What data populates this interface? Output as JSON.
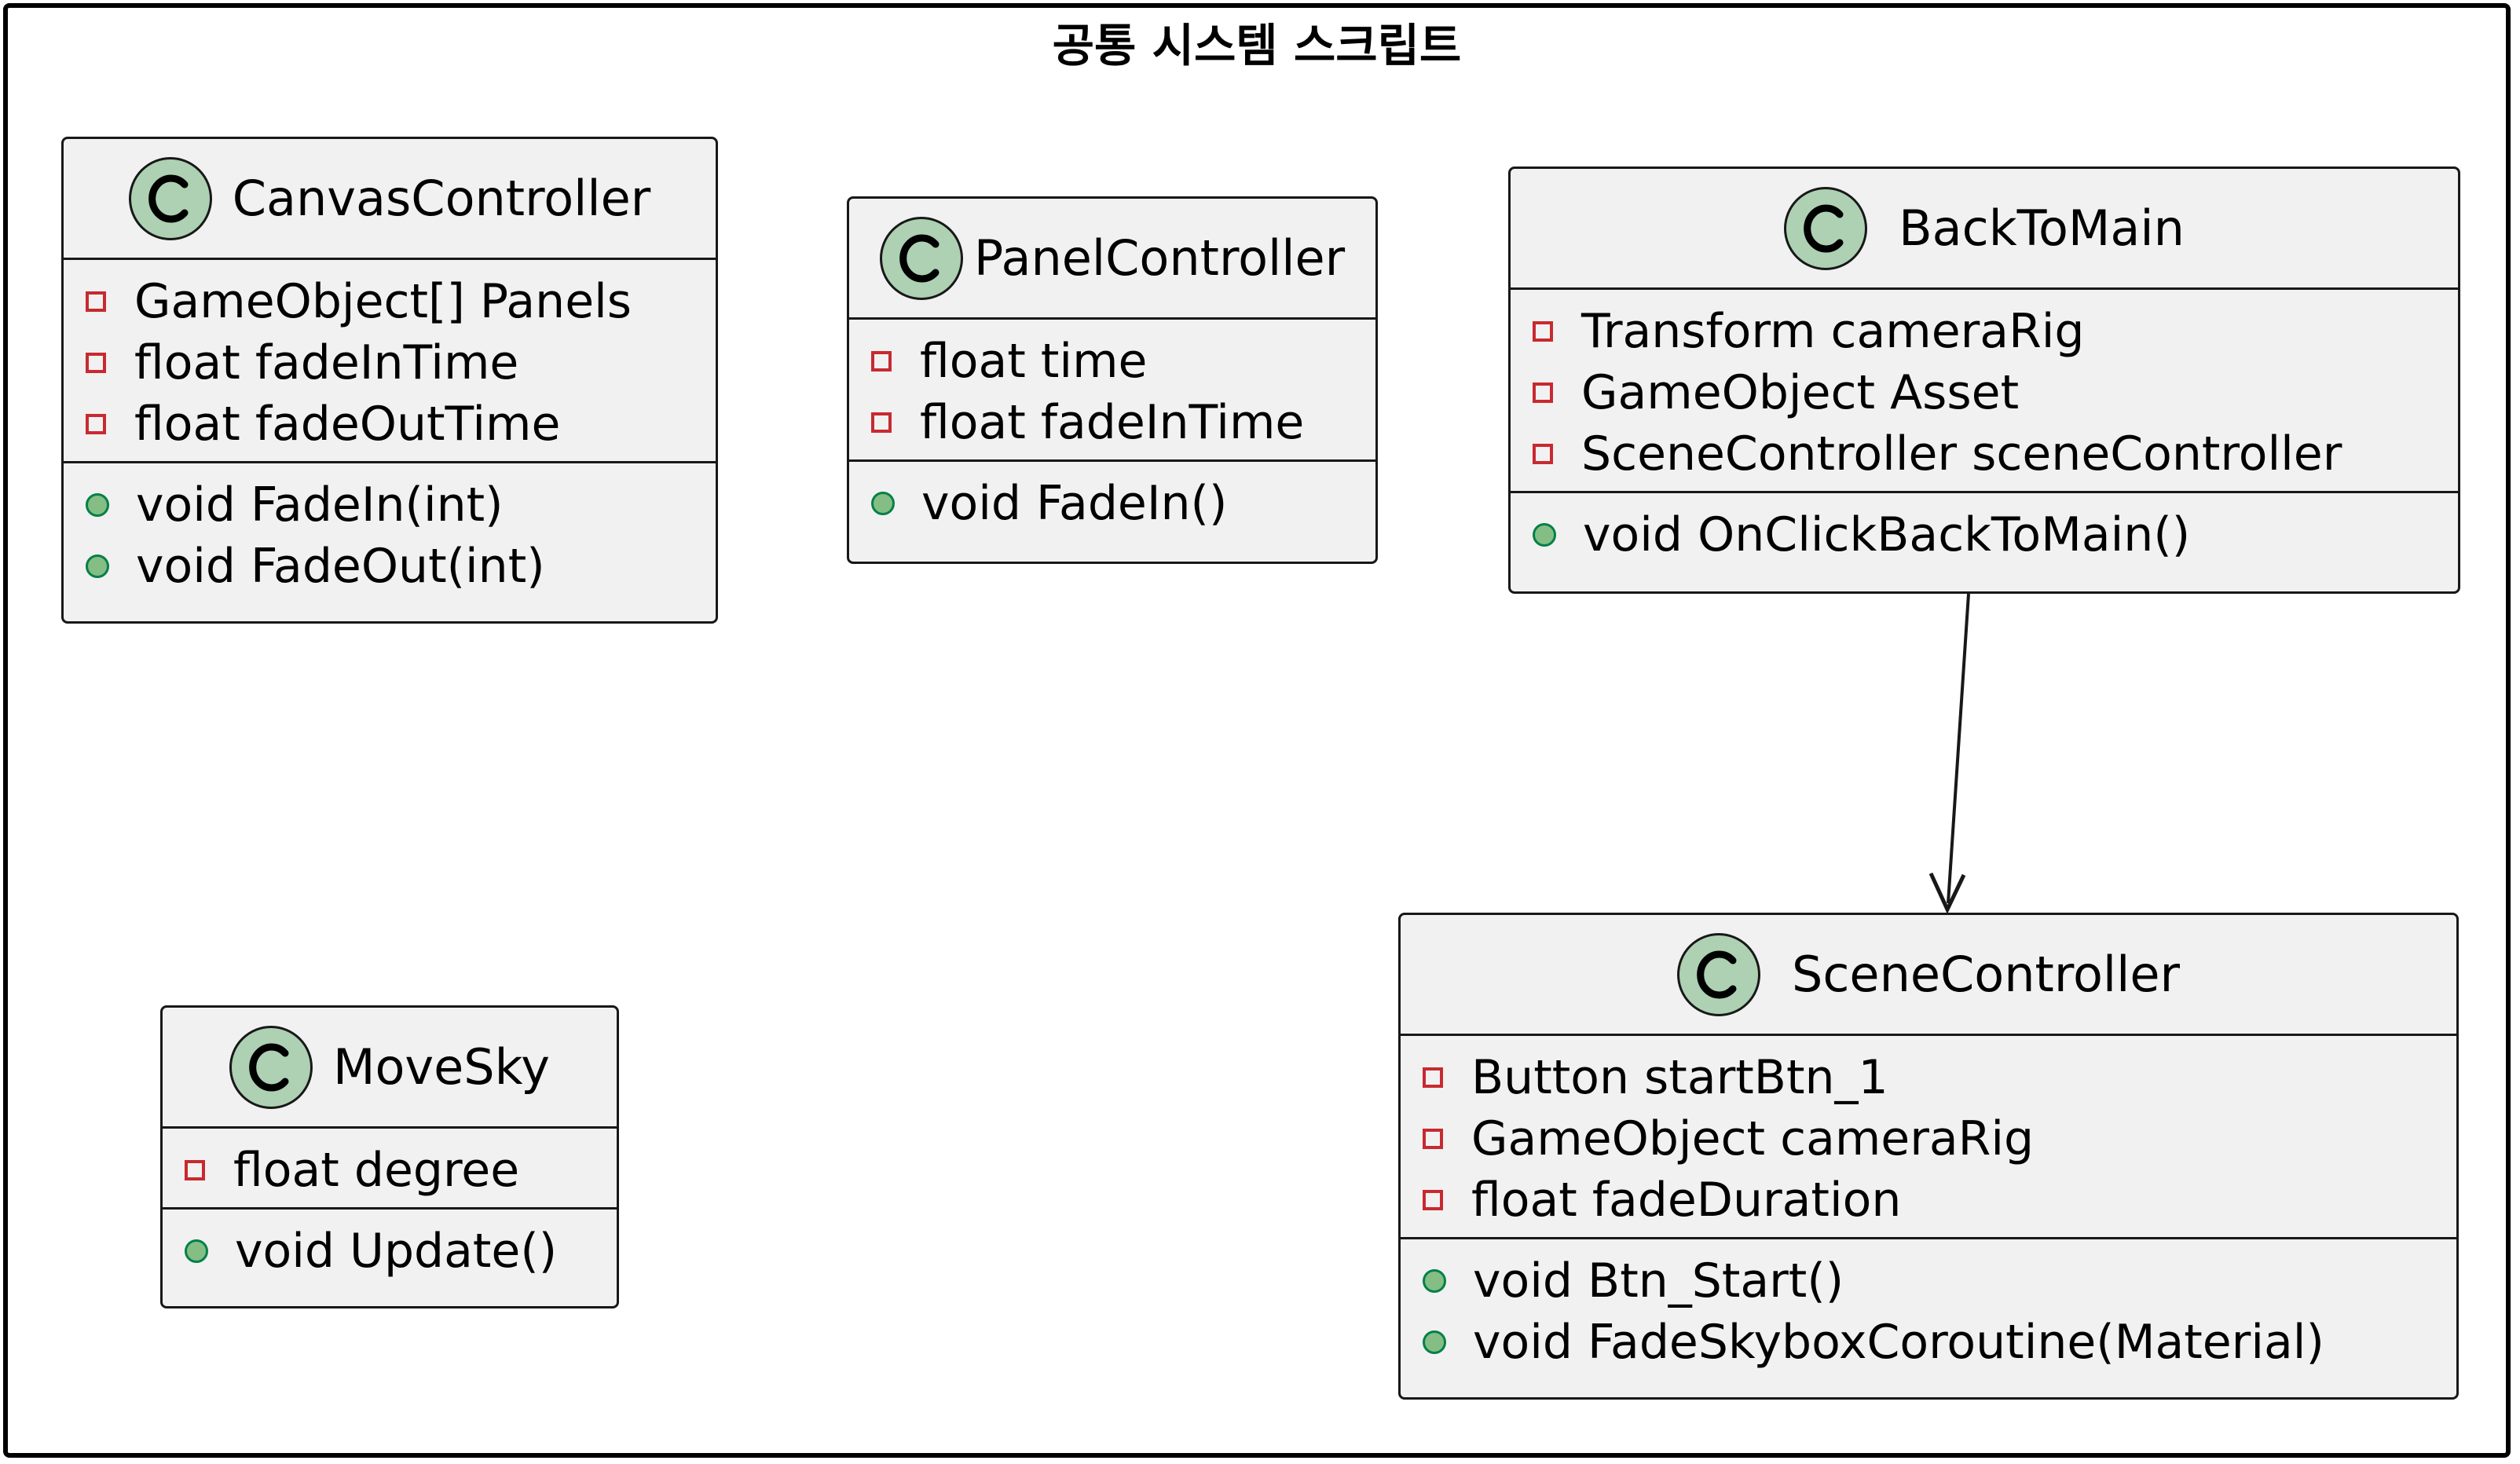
{
  "package": {
    "title": "공통 시스템 스크립트"
  },
  "classes": {
    "canvas_controller": {
      "name": "CanvasController",
      "fields": [
        "GameObject[] Panels",
        "float fadeInTime",
        "float fadeOutTime"
      ],
      "methods": [
        "void FadeIn(int)",
        "void FadeOut(int)"
      ]
    },
    "panel_controller": {
      "name": "PanelController",
      "fields": [
        "float time",
        "float fadeInTime"
      ],
      "methods": [
        "void FadeIn()"
      ]
    },
    "back_to_main": {
      "name": "BackToMain",
      "fields": [
        "Transform cameraRig",
        "GameObject Asset",
        "SceneController sceneController"
      ],
      "methods": [
        "void OnClickBackToMain()"
      ]
    },
    "move_sky": {
      "name": "MoveSky",
      "fields": [
        "float degree"
      ],
      "methods": [
        "void Update()"
      ]
    },
    "scene_controller": {
      "name": "SceneController",
      "fields": [
        "Button startBtn_1",
        "GameObject cameraRig",
        "float fadeDuration"
      ],
      "methods": [
        "void Btn_Start()",
        "void FadeSkyboxCoroutine(Material)"
      ]
    }
  },
  "colors": {
    "class_fill": "#f1f1f1",
    "badge_fill": "#add1b2",
    "private_marker": "#c82930",
    "public_marker": "#84be84"
  },
  "icons": {
    "class_badge": "class-c-icon",
    "private": "private-square-icon",
    "public": "public-circle-icon"
  }
}
